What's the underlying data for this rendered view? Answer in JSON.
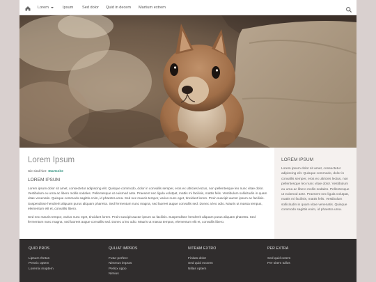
{
  "nav": {
    "items": [
      {
        "label": "Lorem",
        "has_caret": true
      },
      {
        "label": "Ipsum"
      },
      {
        "label": "Sed dolor"
      },
      {
        "label": "Quid in decem"
      },
      {
        "label": "Martium extrem"
      }
    ],
    "icons": {
      "home": "home-icon",
      "search": "search-icon"
    }
  },
  "hero": {
    "image": "squirrel-photo"
  },
  "main": {
    "title": "Lorem Ipsum",
    "breadcrumb": {
      "prefix": "Sie sind hier:",
      "current": "Startseite"
    },
    "section_heading": "LOREM IPSUM",
    "paragraphs": [
      "Lorem ipsum dolor sit amet, consectetur adipiscing elit. Quisque commodo, dolor in convallis semper, eros ex ultricies lectus, non pellentesque leo nunc vitae dolor. Vestibulum eu urna ac libero mollis sodales. Pellentesque ut euismod ante. Praesent nec ligula volutpat, mattis mi facilisis, mattis felis. Vestibulum sollicitudin in quam vitae venenatis. Quisque commodo sagittis enim, id pharetra urna. Sed nec mauris tempor, varius nunc eget, tincidunt lorem. Proin suscipit auctor ipsum ac facilisis. Suspendisse hendrerit aliquam purus aliquam pharetra. Sed fermentum nunc magna, sed laoreet augue convallis sed. Donec a leo odio. Mauris ut massa tempus, elementum elit et, convallis libero.",
      "Sed nec mauris tempor, varius nunc eget, tincidunt lorem. Proin suscipit auctor ipsum ac facilisis. Suspendisse hendrerit aliquam purus aliquam pharetra. Sed fermentum nunc magna, sed laoreet augue convallis sed. Donec a leo odio. Mauris ut massa tempus, elementum elit et, convallis libero."
    ]
  },
  "sidebar": {
    "heading": "LOREM IPSUM",
    "text": "Lorem ipsum dolor sit amet, consectetur adipiscing elit. Quisque commodo, dolor in convallis semper, eros ex ultricies lectus, non pellentesque leo nunc vitae dolor. Vestibulum eu urna ac libero mollis sodales. Pellentesque ut euismod ante. Praesent nec ligula volutpat, mattis mi facilisis, mattis felis. Vestibulum sollicitudin in quam vitae venenatis. Quisque commodo sagittis enim, id pharetra urna."
  },
  "footer": {
    "columns": [
      {
        "heading": "QUID PROS",
        "links": [
          "Lipsum rhetus",
          "Pennix optem",
          "Loremix moptem"
        ]
      },
      {
        "heading": "QULIAT IMPROS",
        "links": [
          "Futur perfect",
          "Nimmus impras",
          "Perlox oppo",
          "Nimius"
        ]
      },
      {
        "heading": "NITRAM EXTRO",
        "links": [
          "Finitas dolor",
          "Sed quid exctem",
          "Nillas optem"
        ]
      },
      {
        "heading": "PER EXTRA",
        "links": [
          "Sed quid octem",
          "Per sitem tullos"
        ]
      }
    ]
  },
  "colors": {
    "accent": "#2a8e7a",
    "footer_bg": "#302d2d",
    "page_bg": "#d9d0cf",
    "sidebar_bg": "#f5f1ef"
  }
}
